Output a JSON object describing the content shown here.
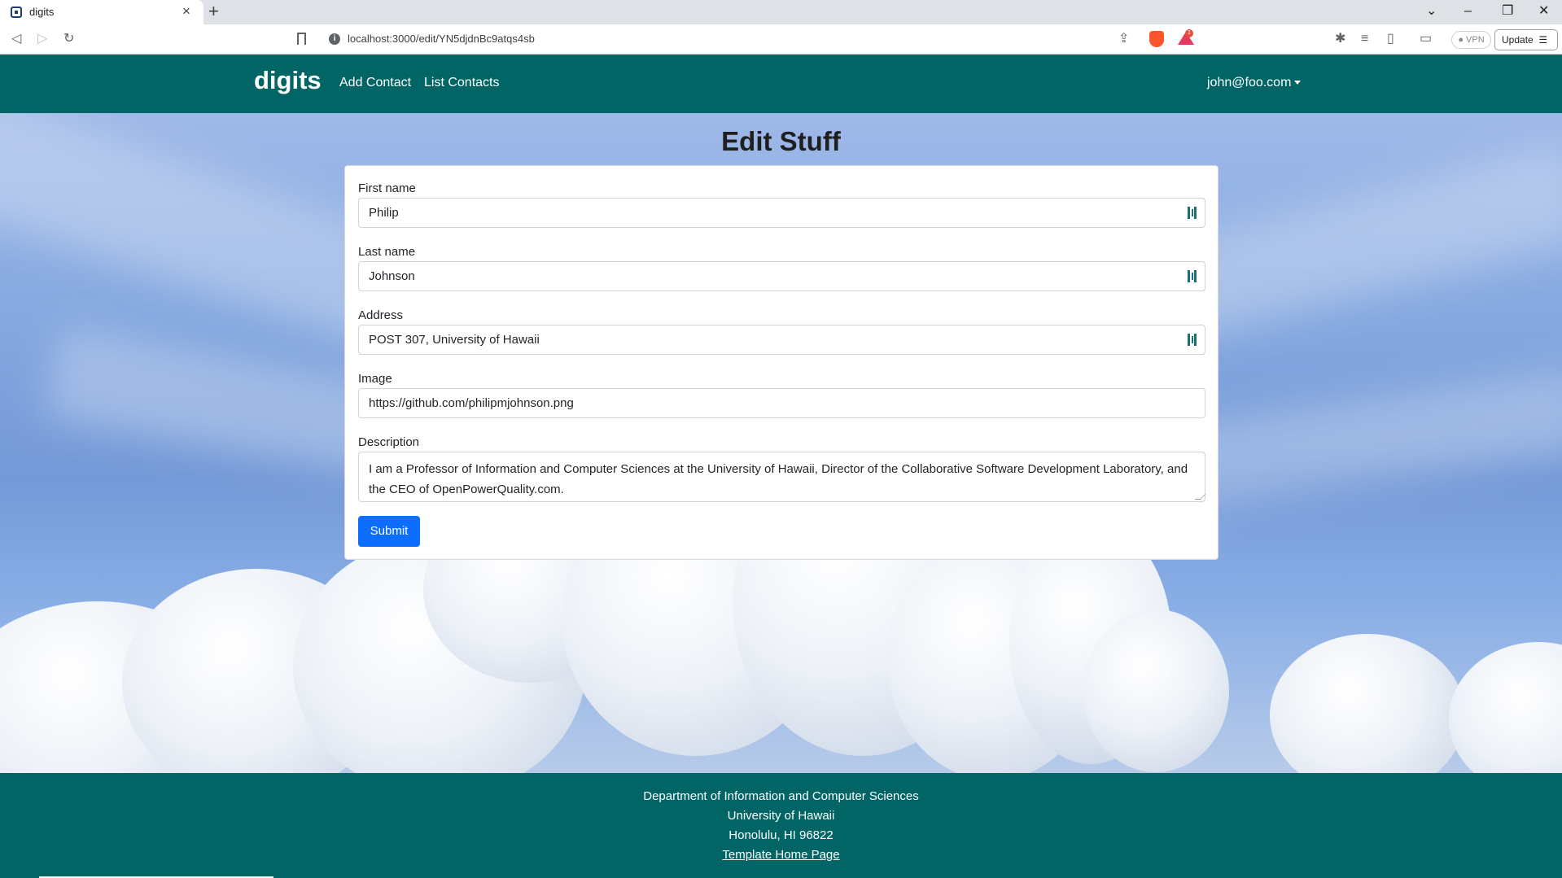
{
  "browser": {
    "tab_title": "digits",
    "url": "localhost:3000/edit/YN5djdnBc9atqs4sb",
    "vpn_label": "VPN",
    "update_label": "Update",
    "rewards_count": "1"
  },
  "navbar": {
    "brand": "digits",
    "links": [
      "Add Contact",
      "List Contacts"
    ],
    "user": "john@foo.com"
  },
  "page": {
    "title": "Edit Stuff"
  },
  "form": {
    "first_name_label": "First name",
    "first_name_value": "Philip",
    "last_name_label": "Last name",
    "last_name_value": "Johnson",
    "address_label": "Address",
    "address_value": "POST 307, University of Hawaii",
    "image_label": "Image",
    "image_value": "https://github.com/philipmjohnson.png",
    "description_label": "Description",
    "description_value": "I am a Professor of Information and Computer Sciences at the University of Hawaii, Director of the Collaborative Software Development Laboratory, and the CEO of OpenPowerQuality.com.",
    "submit_label": "Submit"
  },
  "footer": {
    "line1": "Department of Information and Computer Sciences",
    "line2": "University of Hawaii",
    "line3": "Honolulu, HI 96822",
    "link": "Template Home Page"
  },
  "colors": {
    "navbar": "#016565",
    "submit": "#0d6efd"
  }
}
